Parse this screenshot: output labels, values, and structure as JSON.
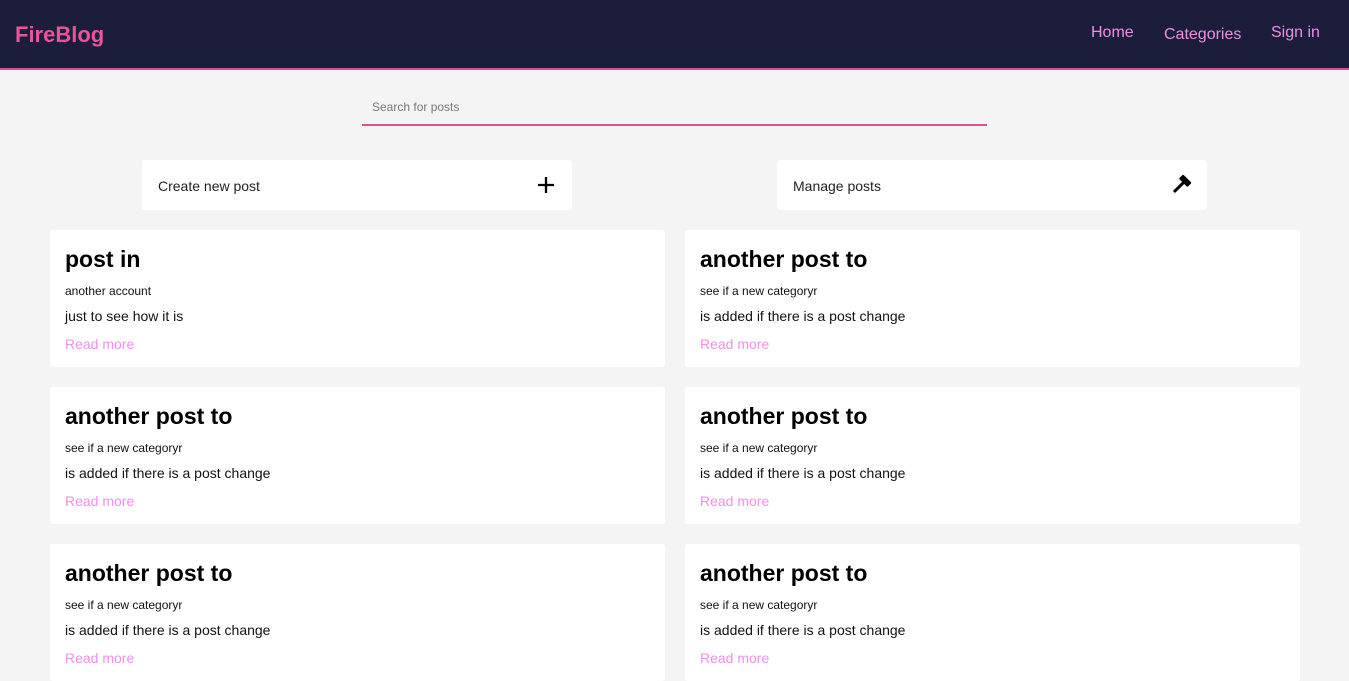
{
  "navbar": {
    "brand": "FireBlog",
    "links": [
      {
        "label": "Home"
      },
      {
        "label": "Categories"
      },
      {
        "label": "Sign in"
      }
    ]
  },
  "search": {
    "placeholder": "Search for posts",
    "value": ""
  },
  "actions": {
    "create": {
      "label": "Create new post",
      "icon": "plus-icon"
    },
    "manage": {
      "label": "Manage posts",
      "icon": "hammer-icon"
    }
  },
  "posts": [
    {
      "title": "post in",
      "subtitle": "another account",
      "excerpt": "just to see how it is",
      "link": "Read more"
    },
    {
      "title": "another post to",
      "subtitle": "see if a new categoryr",
      "excerpt": "is added if there is a post change",
      "link": "Read more"
    },
    {
      "title": "another post to",
      "subtitle": "see if a new categoryr",
      "excerpt": "is added if there is a post change",
      "link": "Read more"
    },
    {
      "title": "another post to",
      "subtitle": "see if a new categoryr",
      "excerpt": "is added if there is a post change",
      "link": "Read more"
    },
    {
      "title": "another post to",
      "subtitle": "see if a new categoryr",
      "excerpt": "is added if there is a post change",
      "link": "Read more"
    },
    {
      "title": "another post to",
      "subtitle": "see if a new categoryr",
      "excerpt": "is added if there is a post change",
      "link": "Read more"
    }
  ],
  "colors": {
    "navbar_bg": "#1b1d3b",
    "brand": "#e6559a",
    "nav_link": "#ee8ee6",
    "accent_border": "#e0508a",
    "read_more": "#f48ee8",
    "page_bg": "#f4f4f4"
  }
}
